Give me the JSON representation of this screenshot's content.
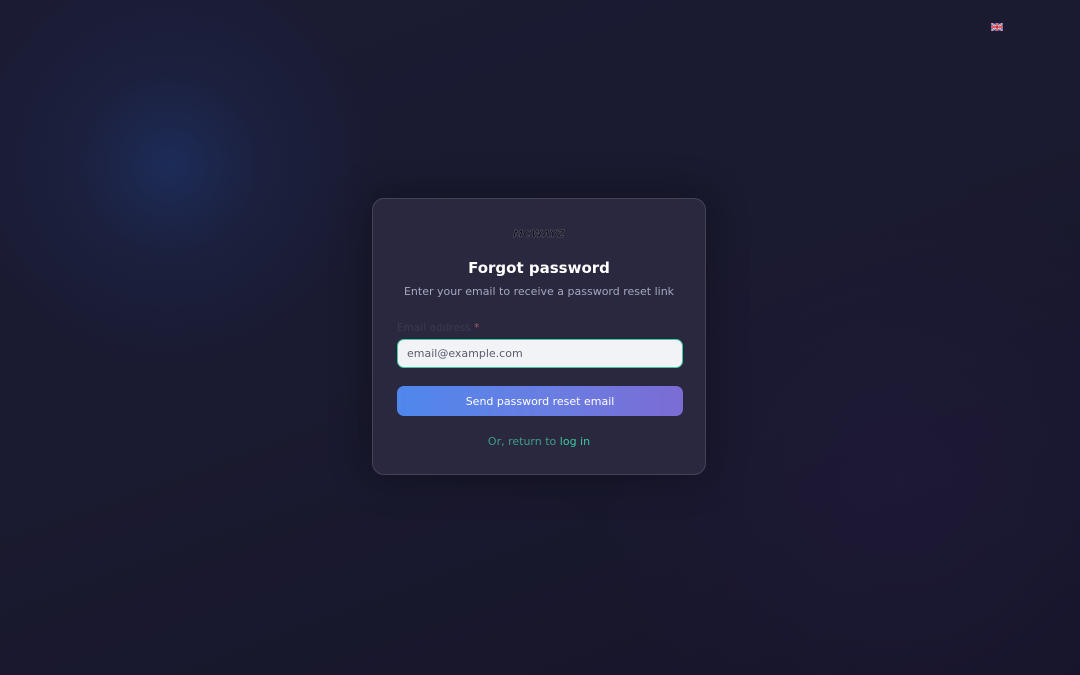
{
  "header": {
    "language_icon": "uk-flag-icon"
  },
  "card": {
    "logo_text": "MCWAYZ",
    "title": "Forgot password",
    "subtitle": "Enter your email to receive a password reset link",
    "email_label": "Email address",
    "required_marker": "*",
    "email_placeholder": "email@example.com",
    "email_value": "",
    "submit_label": "Send password reset email",
    "return_prefix": "Or, return to",
    "login_link": "log in"
  },
  "colors": {
    "accent_teal": "#38c9a0",
    "button_start": "#4f87ec",
    "button_end": "#7b6cd4",
    "card_background": "#2a283e"
  }
}
